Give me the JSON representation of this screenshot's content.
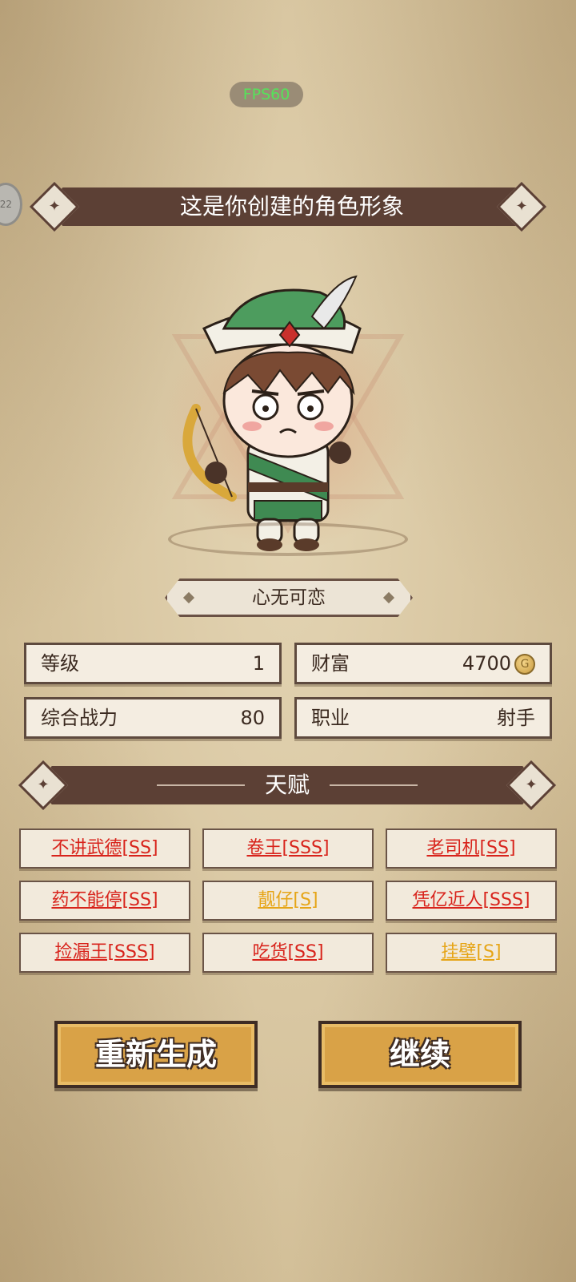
{
  "status": {
    "fps": "FPS60",
    "side_badge": "22"
  },
  "header": {
    "title": "这是你创建的角色形象"
  },
  "character": {
    "name": "心无可恋"
  },
  "stats": {
    "level_label": "等级",
    "level_value": "1",
    "wealth_label": "财富",
    "wealth_value": "4700",
    "power_label": "综合战力",
    "power_value": "80",
    "class_label": "职业",
    "class_value": "射手"
  },
  "talents": {
    "title": "天赋",
    "items": [
      {
        "label": "不讲武德[SS]",
        "color": "#d8231b"
      },
      {
        "label": "卷王[SSS]",
        "color": "#d8231b"
      },
      {
        "label": "老司机[SS]",
        "color": "#d8231b"
      },
      {
        "label": "药不能停[SS]",
        "color": "#d8231b"
      },
      {
        "label": "靓仔[S]",
        "color": "#e6a517"
      },
      {
        "label": "凭亿近人[SSS]",
        "color": "#d8231b"
      },
      {
        "label": "捡漏王[SSS]",
        "color": "#d8231b"
      },
      {
        "label": "吃货[SS]",
        "color": "#d8231b"
      },
      {
        "label": "挂壁[S]",
        "color": "#e6a517"
      }
    ]
  },
  "actions": {
    "regenerate_label": "重新生成",
    "continue_label": "继续"
  }
}
